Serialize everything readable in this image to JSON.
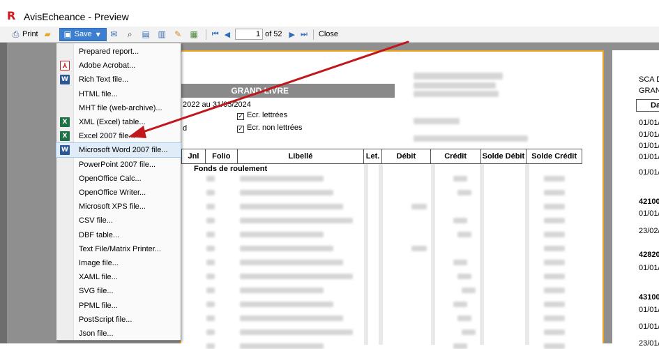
{
  "window": {
    "title": "AvisEcheance - Preview",
    "icon": "fastreport-logo-icon"
  },
  "toolbar": {
    "print_label": "Print",
    "save_label": "Save",
    "page_value": "1",
    "page_total": "of 52",
    "close_label": "Close"
  },
  "save_menu": {
    "items": [
      {
        "label": "Prepared report...",
        "icon": ""
      },
      {
        "label": "Adobe Acrobat...",
        "icon": "pdf-icon"
      },
      {
        "label": "Rich Text file...",
        "icon": "word-icon"
      },
      {
        "label": "HTML file...",
        "icon": ""
      },
      {
        "label": "MHT file (web-archive)...",
        "icon": ""
      },
      {
        "label": "XML (Excel) table...",
        "icon": "excel-icon"
      },
      {
        "label": "Excel 2007 file...",
        "icon": "excel-icon"
      },
      {
        "label": "Microsoft Word 2007 file...",
        "icon": "word-icon"
      },
      {
        "label": "PowerPoint 2007 file...",
        "icon": ""
      },
      {
        "label": "OpenOffice Calc...",
        "icon": ""
      },
      {
        "label": "OpenOffice Writer...",
        "icon": ""
      },
      {
        "label": "Microsoft XPS file...",
        "icon": ""
      },
      {
        "label": "CSV file...",
        "icon": ""
      },
      {
        "label": "DBF table...",
        "icon": ""
      },
      {
        "label": "Text File/Matrix Printer...",
        "icon": ""
      },
      {
        "label": "Image file...",
        "icon": ""
      },
      {
        "label": "XAML file...",
        "icon": ""
      },
      {
        "label": "SVG file...",
        "icon": ""
      },
      {
        "label": "PPML file...",
        "icon": ""
      },
      {
        "label": "PostScript file...",
        "icon": ""
      },
      {
        "label": "Json file...",
        "icon": ""
      }
    ],
    "highlighted_index": 7
  },
  "report": {
    "header_title": "GRAND LIVRE",
    "period_text": "2022 au 31/05/2024",
    "letter_d": "d",
    "check_lettered": "Ecr. lettrées",
    "check_unlettered": "Ecr. non lettrées",
    "columns": [
      "Jnl",
      "Folio",
      "Libellé",
      "Let.",
      "Débit",
      "Crédit",
      "Solde Débit",
      "Solde Crédit"
    ],
    "section_title": "Fonds de roulement"
  },
  "page2": {
    "lines": [
      "SCA D",
      "GRAN"
    ],
    "col_header": "Da",
    "rows": [
      "01/01/",
      "01/01/",
      "01/01/",
      "01/01/",
      "01/01/",
      "42100",
      "01/01/",
      "23/02/",
      "42820",
      "01/01/",
      "43100",
      "01/01/",
      "01/01/",
      "23/01/"
    ]
  },
  "colors": {
    "accent": "#3c7fd1",
    "page_border": "#f0a21b",
    "arrow": "#c0161c"
  }
}
